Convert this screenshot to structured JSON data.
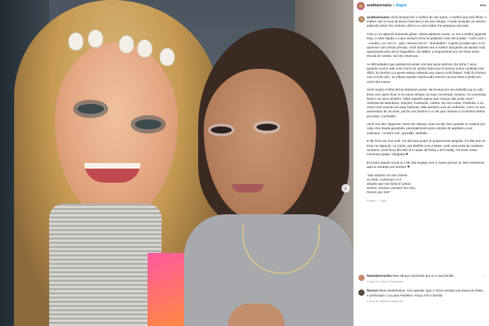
{
  "post": {
    "username": "anathaisrnatos",
    "separator": "•",
    "follow_label": "Seguir",
    "more_label": "•••",
    "carousel_arrow": "›"
  },
  "caption": {
    "paragraphs": [
      "Você sempre fez o melhor de nós todos. A melhor dos seis filhos. A melhor dos 5 Anos da Dona Francisca e do Seu Sérgio. A mais evoluída, já nasceu sabendo amar. Eu costumo dizer a vc sem saber me preparou pra tudo.",
      "Com vc eu aprendi inúmeras gírias, várias palavras novas, vc era a melhor jogando stop, a mais rápida e a que sempre tinha as palavras mais decoradas: \"carro com L - Landau, cor com G - gelo, animal com D - dromedário\" a gente já sabia que vc ia aparecer com essas pérolas. Você também era a melhor dançarina de samba rock, apaixonada pelo Zeca Pagodinho, Zé Wilker, a responsável por me fazer amar escola de samba: Vai Vai e Barroca.",
      "As dificuldades que passamos juntas nos deu laços eternos. Eu tinha 7 anos quando você e mãe num morro do Jardim Zaíra pra te buscar numa condição mto difícil. Eu lembro q a gente estava voltando pra casa e você falava: \"Não fica brava com a irmã não\", eu olhava aquele machucado imenso na sua testa e pedia pra você não morrer.",
      "Você mudou minha forma inúmeras vezes. Me levava pro seu trabalho pq eu não tinha com quem ficar, e eu ouvia sempre as suas conversas, sempre. As conversas boas e as ruins também. Sabe aqueles papos que criança não pode ouvir? Histórias de abandono, traições, frustração, medos. Eu ouvi todos. Paulinha, e eu chorei mto ouvindo as suas histórias. Mas também ouvi as melhores, como no seu aniversário de 15 anos, pai fez um bolinho e vc dis que chamou a Cunhinha inteira pra festa. Confusão!",
      "Você nos deu \"algumas\" dores de cabeça, mas era tão bom quando vc voltava pra casa. Era risada garantida, principalmente pela coleção de apelidos q nos colocava: \"crocken nai\", grandão, abelhão.",
      "E tão bom ser sua irmã. Foi tão bom poder te proporcionar alegrias. Foi tão bom te levar na Sapucaí, no Cristo, pra desfilar com a MuM, curtir uma praia de madame na Barra. Você ficou tão feliz em cuidar da Pinky e do Freddy. Foi lindo nosso momento juntas. Obrigada ❤",
      "Encontra aquele coroa ai e dê mta risadas com o nosso pai por aí. Nós estaremos aqui te amando pra sempre ❤",
      "\"Irão utilizem um tom solene\nou triste, continuem a rir\ndaquilo que nos fazia rir juntos.\nRezem, sorriam, pensem em mim.\nRezem por mim\""
    ],
    "time": "Editado · 1 sem"
  },
  "comments": [
    {
      "username": "fatimabernardes",
      "text": "Meu abraço carinhoso pra vc e sua família.",
      "meta": "1 sem  44 curtidas  Responder",
      "avatar_color": "#c48a6a"
    },
    {
      "username": "flavioxi",
      "text": "Meus sentimentos. Ana querida. Que o Orum receba sua mana em festa e perfumado. Luz para Paulinha. Força a fé e família.",
      "meta": "1 sem  18 curtidas  Responder",
      "avatar_color": "#5a4a3a"
    }
  ],
  "icons": {
    "heart": "♡"
  }
}
